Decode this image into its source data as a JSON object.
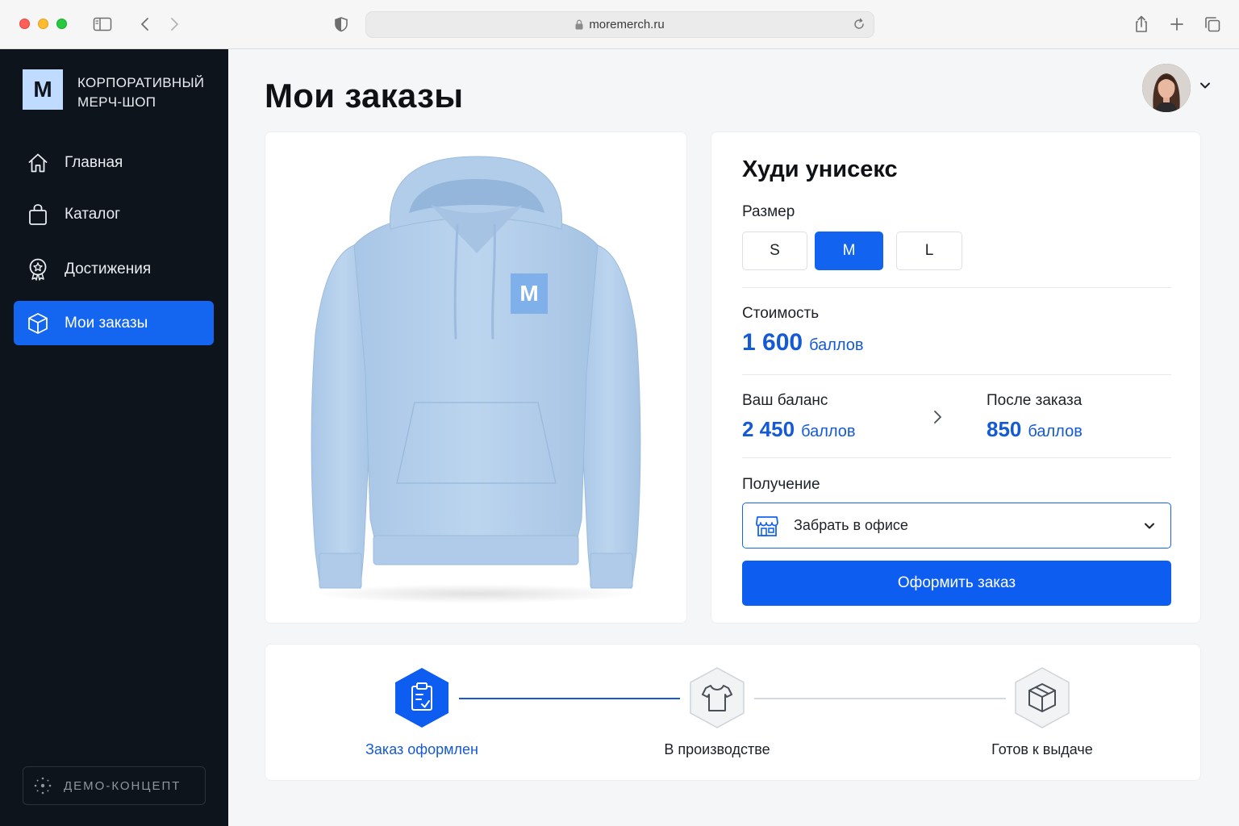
{
  "browser": {
    "url": "moremerch.ru"
  },
  "sidebar": {
    "logo_letter": "M",
    "brand_line1": "КОРПОРАТИВНЫЙ",
    "brand_line2": "МЕРЧ-ШОП",
    "items": [
      {
        "label": "Главная",
        "icon": "home-icon",
        "active": false
      },
      {
        "label": "Каталог",
        "icon": "shopping-bag-icon",
        "active": false
      },
      {
        "label": "Достижения",
        "icon": "award-icon",
        "active": false
      },
      {
        "label": "Мои заказы",
        "icon": "box-icon",
        "active": true
      }
    ],
    "demo_label": "ДЕМО-КОНЦЕПТ"
  },
  "main": {
    "page_title": "Мои заказы"
  },
  "product": {
    "logo_letter": "M",
    "name": "Худи унисекс",
    "size_label": "Размер",
    "sizes": [
      "S",
      "M",
      "L"
    ],
    "selected_size": "M",
    "cost_label": "Стоимость",
    "cost_value": "1 600",
    "cost_unit": "баллов",
    "balance_label": "Ваш баланс",
    "balance_value": "2 450",
    "balance_unit": "баллов",
    "after_label": "После заказа",
    "after_value": "850",
    "after_unit": "баллов",
    "delivery_label": "Получение",
    "delivery_value": "Забрать в офисе",
    "order_button": "Оформить заказ"
  },
  "tracker": {
    "steps": [
      {
        "label": "Заказ оформлен",
        "icon": "clipboard-check-icon",
        "state": "done"
      },
      {
        "label": "В производстве",
        "icon": "tshirt-icon",
        "state": "pending"
      },
      {
        "label": "Готов к выдаче",
        "icon": "package-icon",
        "state": "pending"
      }
    ]
  },
  "colors": {
    "accent": "#1163f0",
    "sidebar_bg": "#0d141b",
    "hoodie": "#b9d3ee"
  }
}
